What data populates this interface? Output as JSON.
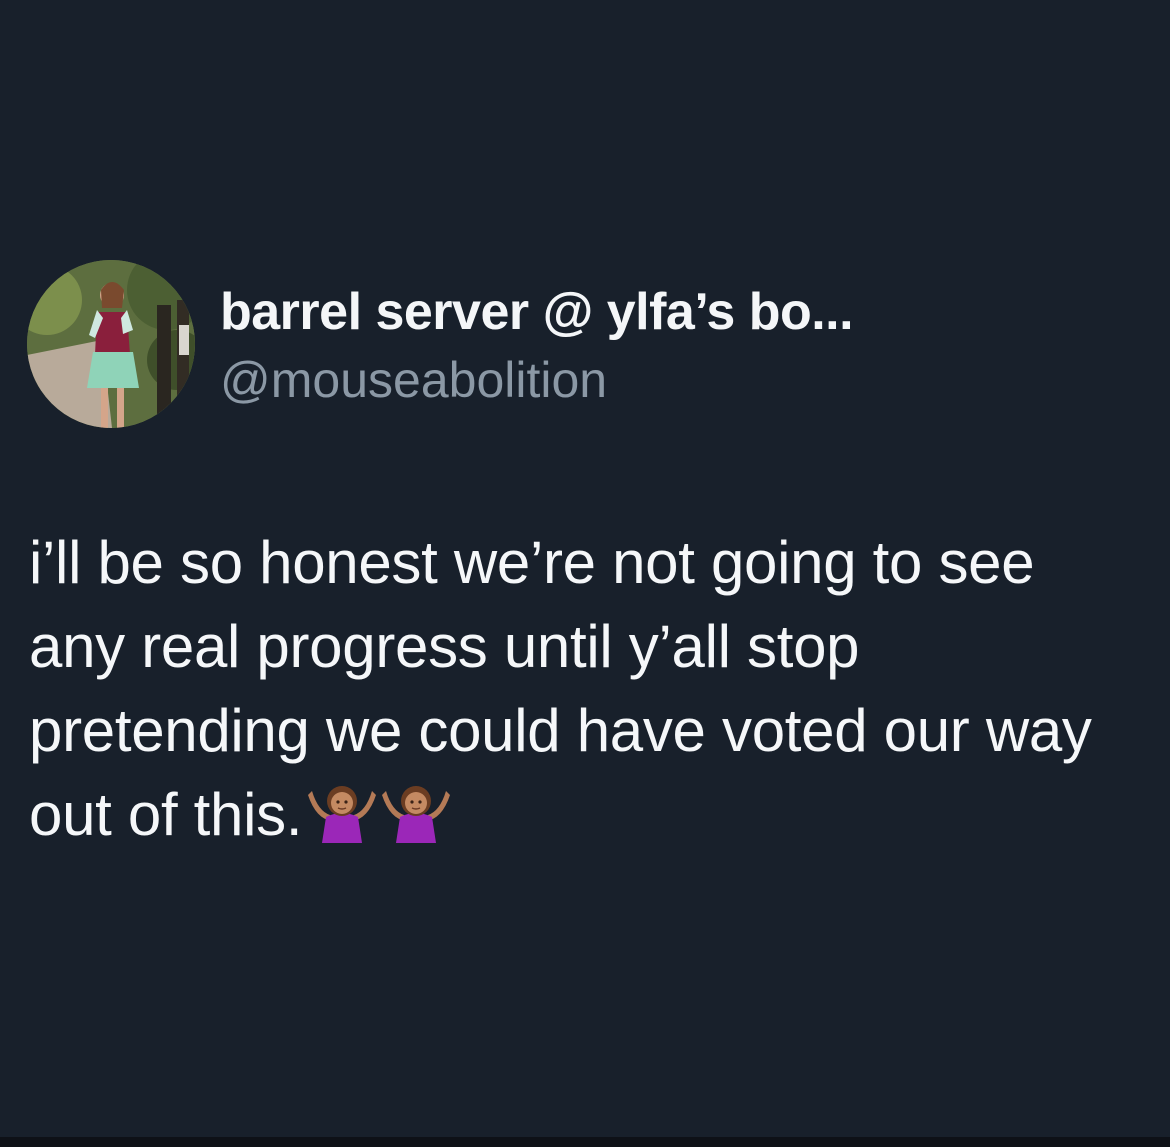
{
  "tweet": {
    "author": {
      "display_name": "barrel server @ ylfa’s bo...",
      "handle": "@mouseabolition",
      "avatar": "profile-photo"
    },
    "text": "i’ll be so honest we’re not going to see any real progress until y’all stop pretending we could have voted our way out of this.",
    "emojis": [
      "person-shrugging-emoji",
      "person-shrugging-emoji"
    ]
  },
  "colors": {
    "background": "#18202b",
    "text_primary": "#f5f7f9",
    "text_secondary": "#8b98a5"
  }
}
